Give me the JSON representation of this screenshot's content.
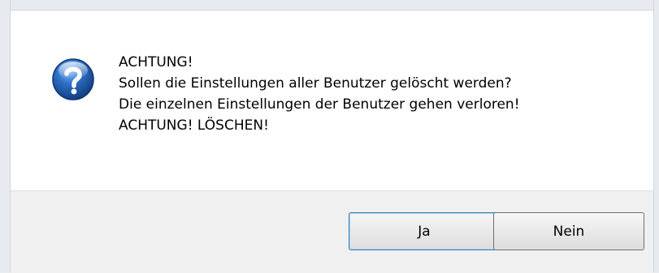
{
  "dialog": {
    "message_lines": [
      "ACHTUNG!",
      "Sollen die Einstellungen aller Benutzer gelöscht werden?",
      "Die einzelnen Einstellungen der Benutzer gehen verloren!",
      "ACHTUNG! LÖSCHEN!"
    ],
    "icon": "question-icon",
    "buttons": {
      "yes_label": "Ja",
      "no_label": "Nein"
    }
  },
  "colors": {
    "icon_blue": "#1f5fae",
    "default_button_border": "#3c7fb1"
  }
}
